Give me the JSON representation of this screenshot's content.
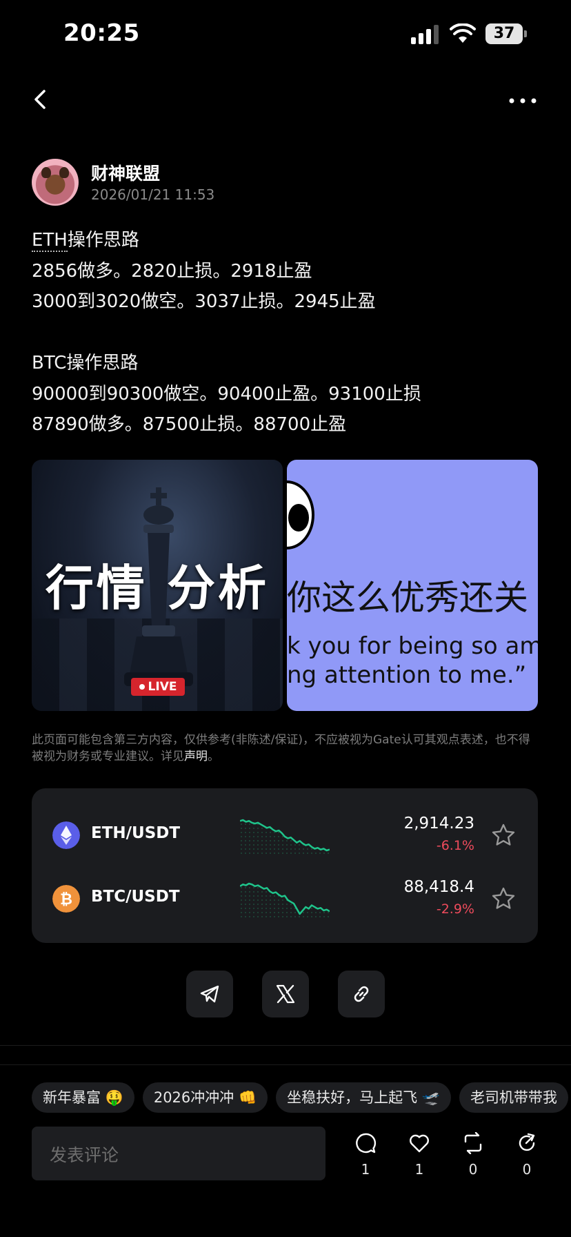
{
  "status_bar": {
    "time": "20:25",
    "battery": "37"
  },
  "author": {
    "name": "财神联盟",
    "date": "2026/01/21 11:53"
  },
  "post": {
    "lines": [
      {
        "pre": "",
        "dotted": "ETH",
        "post": "操作思路"
      },
      {
        "pre": "2856做多。2820止损。2918止盈"
      },
      {
        "pre": "3000到3020做空。3037止损。2945止盈"
      },
      {
        "pre": ""
      },
      {
        "pre": "BTC操作思路"
      },
      {
        "pre": "90000到90300做空。90400止盈。93100止损"
      },
      {
        "pre": "87890做多。87500止损。88700止盈"
      }
    ]
  },
  "images": {
    "img1": {
      "title": "行情 分析",
      "badge": "LIVE"
    },
    "img2": {
      "cn": "你这么优秀还关",
      "en1": "k you for being so amaz",
      "en2": "ng attention to me.”"
    }
  },
  "disclaimer": {
    "text": "此页面可能包含第三方内容，仅供参考(非陈述/保证)，不应被视为Gate认可其观点表述，也不得被视为财务或专业建议。详见",
    "link": "声明",
    "end": "。"
  },
  "market": [
    {
      "pair": "ETH/USDT",
      "price": "2,914.23",
      "change": "-6.1%",
      "coin_color": "#5a5ee8",
      "icon": "ethereum-icon",
      "spark": [
        10,
        9,
        11,
        10,
        12,
        13,
        12,
        14,
        16,
        18,
        17,
        20,
        22,
        21,
        24,
        28,
        30,
        29,
        32,
        35,
        33,
        36,
        38,
        37,
        40,
        42,
        41,
        43,
        42,
        44,
        43
      ]
    },
    {
      "pair": "BTC/USDT",
      "price": "88,418.4",
      "change": "-2.9%",
      "coin_color": "#f0923b",
      "icon": "bitcoin-icon",
      "spark": [
        12,
        10,
        11,
        9,
        10,
        12,
        11,
        13,
        15,
        14,
        18,
        20,
        19,
        22,
        24,
        23,
        28,
        30,
        32,
        38,
        44,
        40,
        36,
        38,
        34,
        36,
        38,
        37,
        40,
        39,
        41
      ]
    }
  ],
  "tags": [
    "新年暴富 🤑",
    "2026冲冲冲 👊",
    "坐稳扶好，马上起飞 🛫",
    "老司机带带我"
  ],
  "comment": {
    "placeholder": "发表评论"
  },
  "actions": {
    "comments": "1",
    "likes": "1",
    "reposts": "0",
    "shares": "0"
  },
  "colors": {
    "accent_green": "#1fc48b",
    "loss_red": "#ef4b5c",
    "card_bg": "#1b1c1f"
  }
}
